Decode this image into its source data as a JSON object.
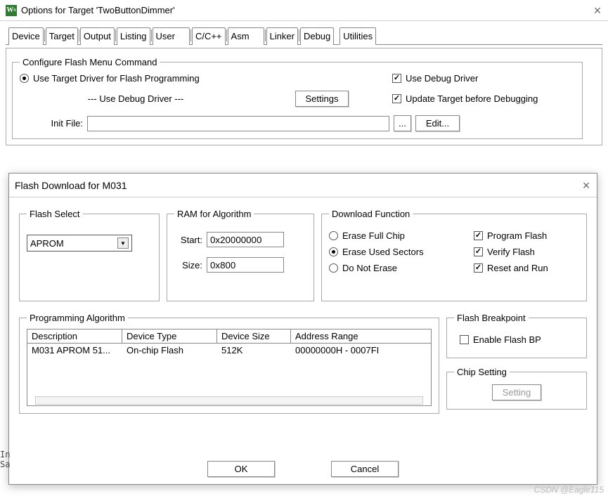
{
  "parent": {
    "title": "Options for Target 'TwoButtonDimmer'",
    "tabs": [
      "Device",
      "Target",
      "Output",
      "Listing",
      "User",
      "C/C++",
      "Asm",
      "Linker",
      "Debug",
      "Utilities"
    ],
    "activeTab": "Utilities",
    "config": {
      "legend": "Configure Flash Menu Command",
      "useTargetDriver": "Use Target Driver for Flash Programming",
      "debugDriverLine": "--- Use Debug Driver ---",
      "settingsBtn": "Settings",
      "useDebugDriver": "Use Debug Driver",
      "updateTarget": "Update Target before Debugging",
      "initFileLabel": "Init File:",
      "initFileValue": "",
      "browseBtn": "...",
      "editBtn": "Edit..."
    }
  },
  "dialog": {
    "title": "Flash Download for M031",
    "flashSelect": {
      "legend": "Flash Select",
      "value": "APROM"
    },
    "ram": {
      "legend": "RAM for Algorithm",
      "startLabel": "Start:",
      "start": "0x20000000",
      "sizeLabel": "Size:",
      "size": "0x800"
    },
    "dlfunc": {
      "legend": "Download Function",
      "r1": "Erase Full Chip",
      "r2": "Erase Used Sectors",
      "r3": "Do Not Erase",
      "c1": "Program Flash",
      "c2": "Verify Flash",
      "c3": "Reset and Run"
    },
    "prog": {
      "legend": "Programming Algorithm",
      "headers": {
        "desc": "Description",
        "type": "Device Type",
        "size": "Device Size",
        "range": "Address Range"
      },
      "row": {
        "desc": "M031 APROM 51...",
        "type": "On-chip Flash",
        "size": "512K",
        "range": "00000000H - 0007FI"
      }
    },
    "fbp": {
      "legend": "Flash Breakpoint",
      "label": "Enable Flash BP"
    },
    "chip": {
      "legend": "Chip Setting",
      "btn": "Setting"
    },
    "ok": "OK",
    "cancel": "Cancel"
  },
  "watermark": "CSDN @Eagle115",
  "stub1": "In",
  "stub2": "Sa"
}
